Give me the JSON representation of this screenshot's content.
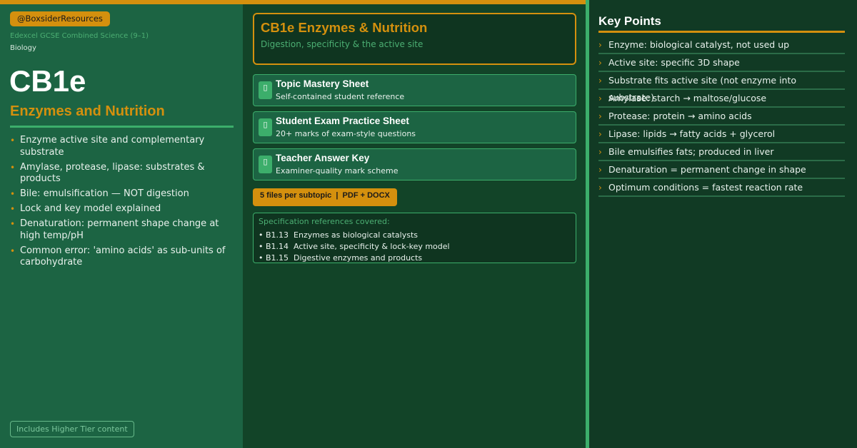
{
  "brand": {
    "handle": "@BoxsiderResources",
    "exam_board": "Edexcel GCSE Combined Science (9–1)",
    "subject": "Biology"
  },
  "left": {
    "code": "CB1e",
    "topic": "Enzymes and Nutrition",
    "bullets": [
      "Enzyme active site and complementary substrate",
      "Amylase, protease, lipase: substrates & products",
      "Bile: emulsification — NOT digestion",
      "Lock and key model explained",
      "Denaturation: permanent shape change at high temp/pH",
      "Common error: 'amino acids' as sub-units of carbohydrate"
    ],
    "tier_note": "Includes Higher Tier content"
  },
  "middle": {
    "title": "CB1e Enzymes & Nutrition",
    "subtitle": "Digestion, specificity & the active site",
    "files": [
      {
        "title": "Topic Mastery Sheet",
        "desc": "Self-contained student reference"
      },
      {
        "title": "Student Exam Practice Sheet",
        "desc": "20+ marks of exam-style questions"
      },
      {
        "title": "Teacher Answer Key",
        "desc": "Examiner-quality mark scheme"
      }
    ],
    "badge": "5 files per subtopic  |  PDF + DOCX",
    "spec_heading": "Specification references covered:",
    "spec_refs": [
      "• B1.13  Enzymes as biological catalysts",
      "• B1.14  Active site, specificity & lock-key model",
      "• B1.15  Digestive enzymes and products"
    ]
  },
  "key_points": {
    "title": "Key Points",
    "items": [
      "Enzyme: biological catalyst, not used up",
      "Active site: specific 3D shape",
      "Substrate fits active site (not enzyme into substrate)",
      "Amylase: starch → maltose/glucose",
      "Protease: protein → amino acids",
      "Lipase: lipids → fatty acids + glycerol",
      "Bile emulsifies fats; produced in liver",
      "Denaturation = permanent change in shape",
      "Optimum conditions = fastest reaction rate"
    ]
  },
  "icons": {
    "file_icon": "document-icon",
    "bullet_icon": "bullet-dot-icon",
    "key_point_icon": "chevron-right-icon"
  },
  "colors": {
    "accent_gold": "#d4900e",
    "accent_green": "#3cae6b",
    "panel_green": "#1c6443",
    "dark_green": "#113a24"
  }
}
